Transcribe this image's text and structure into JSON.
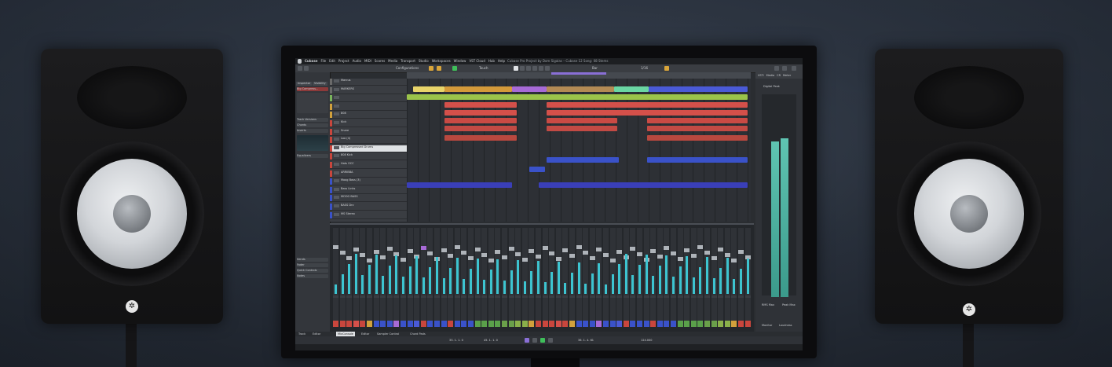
{
  "scene": {
    "speaker_logo_icon": "tuning-fork-logo-icon"
  },
  "daw": {
    "app_name": "Cubase",
    "menu": [
      "Cubase",
      "File",
      "Edit",
      "Project",
      "Audio",
      "MIDI",
      "Scores",
      "Media",
      "Transport",
      "Studio",
      "Workspaces",
      "Window",
      "VST Cloud",
      "Hub",
      "Help"
    ],
    "window_title": "Cubase Pro Project by Dom Sigalas – Cubase 12 Song: 08 Stems",
    "toolbar": {
      "configurations_label": "Configurations",
      "touch_label": "Touch",
      "bar_label": "Bar",
      "zoom_label": "1/16"
    },
    "inspector": {
      "tabs": [
        "Inspector",
        "Visibility"
      ],
      "track_name": "Big Compress...",
      "sections": [
        "Track Versions",
        "Chords",
        "Inserts",
        "Equalizers",
        "Sends",
        "Fader",
        "Quick Controls",
        "Notes"
      ]
    },
    "tracks": [
      {
        "name": "Marcus",
        "color": "#6a6a6a"
      },
      {
        "name": "MARKERS",
        "color": "#6a6a6a"
      },
      {
        "name": "",
        "color": "#7ab55c"
      },
      {
        "name": "",
        "color": "#d2a13c"
      },
      {
        "name": "808",
        "color": "#d2a13c"
      },
      {
        "name": "Kick",
        "color": "#c9463d"
      },
      {
        "name": "Snare",
        "color": "#c9463d"
      },
      {
        "name": "Loo (4)",
        "color": "#c9463d"
      },
      {
        "name": "Big Compressed Drums",
        "color": "#c9463d"
      },
      {
        "name": "808 Kick",
        "color": "#c9463d"
      },
      {
        "name": "Hats OCC",
        "color": "#c9463d"
      },
      {
        "name": "ARRIBBA",
        "color": "#c9463d"
      },
      {
        "name": "Moog Bass (3)",
        "color": "#3a52c9"
      },
      {
        "name": "Bass Links",
        "color": "#3a52c9"
      },
      {
        "name": "MOOG BASS",
        "color": "#3a52c9"
      },
      {
        "name": "BASS Drv",
        "color": "#3a52c9"
      },
      {
        "name": "MS Stereo",
        "color": "#3a52c9"
      }
    ],
    "right_zone_tabs": [
      "VSTi",
      "Media",
      "CR",
      "Meter"
    ],
    "meter_labels": [
      "Digital Peak",
      "RMS Max",
      "Peak Max"
    ],
    "bottom_tabs": [
      "Track",
      "Editor",
      "MixConsole",
      "Editor",
      "Sampler Control",
      "Chord Pads"
    ],
    "transport": {
      "left_locator": "33. 1. 1. 0",
      "right_locator": "45. 1. 1. 0",
      "position": "36. 1. 4. 61",
      "tempo": "124.000"
    },
    "loudness_label": "Loudness",
    "monitor_label": "Monitor"
  }
}
